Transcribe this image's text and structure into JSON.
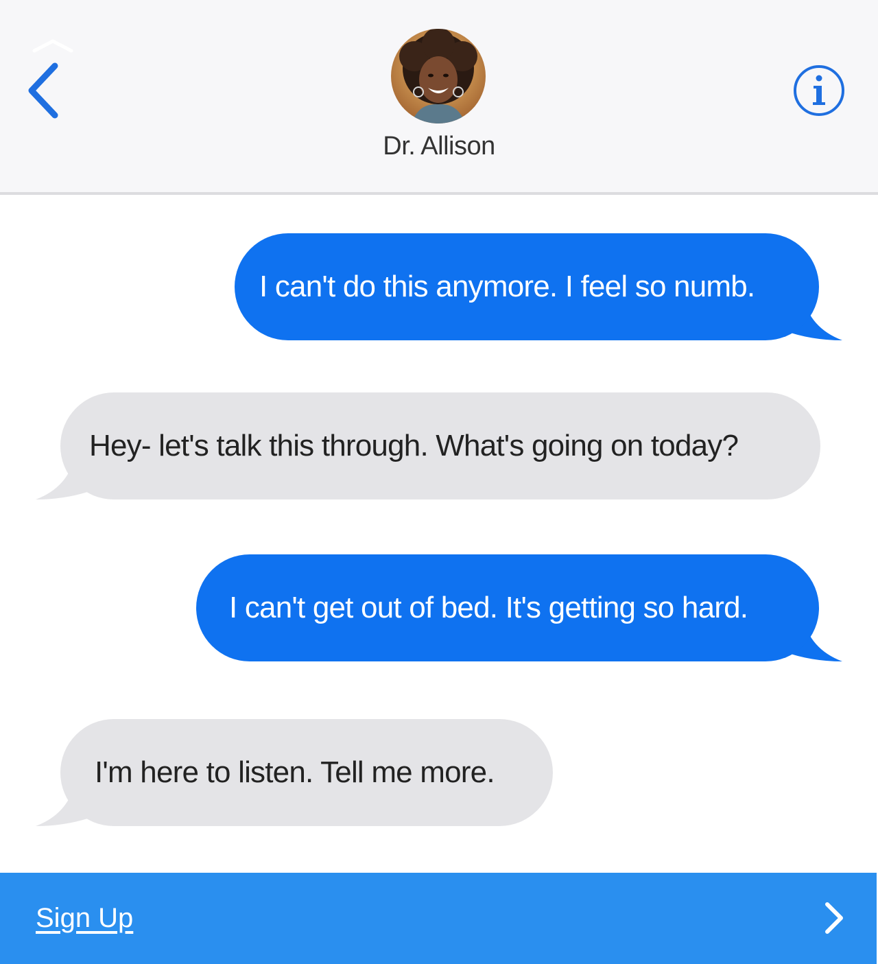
{
  "header": {
    "contact_name": "Dr. Allison",
    "back_icon": "chevron-left-icon",
    "info_icon": "info-icon",
    "accent_color": "#1f6fe0"
  },
  "messages": [
    {
      "direction": "sent",
      "text": "I can't do this anymore. I feel so numb."
    },
    {
      "direction": "received",
      "text": "Hey- let's talk this through. What's going on today?"
    },
    {
      "direction": "sent",
      "text": "I can't get out of bed. It's getting so hard."
    },
    {
      "direction": "received",
      "text": "I'm here to listen. Tell me more."
    }
  ],
  "colors": {
    "sent_bubble": "#0f72f0",
    "received_bubble": "#e4e4e7",
    "footer": "#2a8fef"
  },
  "footer": {
    "signup_label": "Sign Up",
    "arrow_icon": "chevron-right-icon"
  }
}
